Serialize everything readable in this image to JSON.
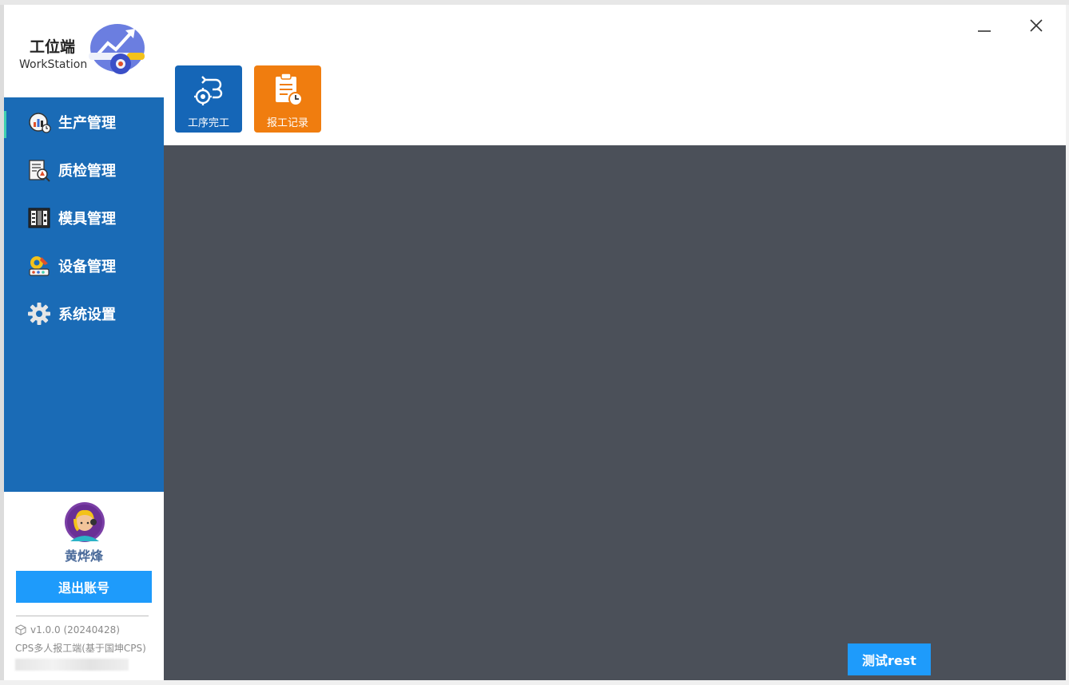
{
  "app": {
    "title": "工位端",
    "subtitle": "WorkStation"
  },
  "window_controls": {
    "minimize_icon": "minimize-icon",
    "close_icon": "close-icon"
  },
  "toolbar": {
    "tiles": [
      {
        "label": "工序完工",
        "icon": "process-gear-icon",
        "color": "#1566b7"
      },
      {
        "label": "报工记录",
        "icon": "clipboard-clock-icon",
        "color": "#f07d0f"
      }
    ]
  },
  "sidebar": {
    "background": "#1a6bb6",
    "items": [
      {
        "label": "生产管理",
        "icon": "production-icon",
        "active": true
      },
      {
        "label": "质检管理",
        "icon": "quality-inspection-icon"
      },
      {
        "label": "模具管理",
        "icon": "mold-icon"
      },
      {
        "label": "设备管理",
        "icon": "equipment-icon"
      },
      {
        "label": "系统设置",
        "icon": "gear-icon"
      }
    ]
  },
  "user": {
    "name": "黄烨烽",
    "logout_label": "退出账号",
    "version": "v1.0.0 (20240428)",
    "description": "CPS多人报工端(基于国坤CPS)"
  },
  "content": {
    "background": "#4b5059",
    "test_button_label": "测试rest"
  },
  "colors": {
    "accent": "#1e9bfb",
    "active_indicator": "#3fd0b0"
  }
}
